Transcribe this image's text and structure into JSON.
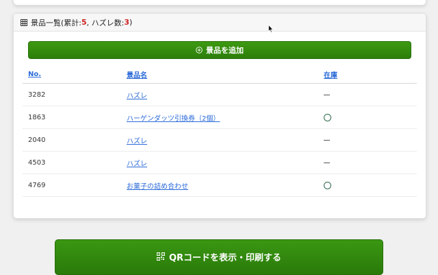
{
  "card": {
    "title": "景品一覧",
    "summary_open": " (累計: ",
    "total_count": "5",
    "summary_mid": ", ハズレ数: ",
    "miss_count": "3",
    "summary_close": ")",
    "table_icon": "table-icon"
  },
  "add_button": {
    "label": "景品を追加",
    "icon": "plus-circle-icon"
  },
  "table": {
    "headers": {
      "no": "No.",
      "name": "景品名",
      "stock": "在庫"
    },
    "rows": [
      {
        "no": "3282",
        "name": "ハズレ",
        "stock": "none"
      },
      {
        "no": "1863",
        "name": "ハーゲンダッツ引換券（2個）",
        "stock": "available"
      },
      {
        "no": "2040",
        "name": "ハズレ",
        "stock": "none"
      },
      {
        "no": "4503",
        "name": "ハズレ",
        "stock": "none"
      },
      {
        "no": "4769",
        "name": "お菓子の詰め合わせ",
        "stock": "available"
      }
    ]
  },
  "qr_button": {
    "label": "QRコードを表示・印刷する",
    "icon": "qr-code-icon"
  },
  "colors": {
    "primary_green": "#2c7e0a",
    "link_blue": "#2a6ad8",
    "count_red": "#cc2222"
  }
}
